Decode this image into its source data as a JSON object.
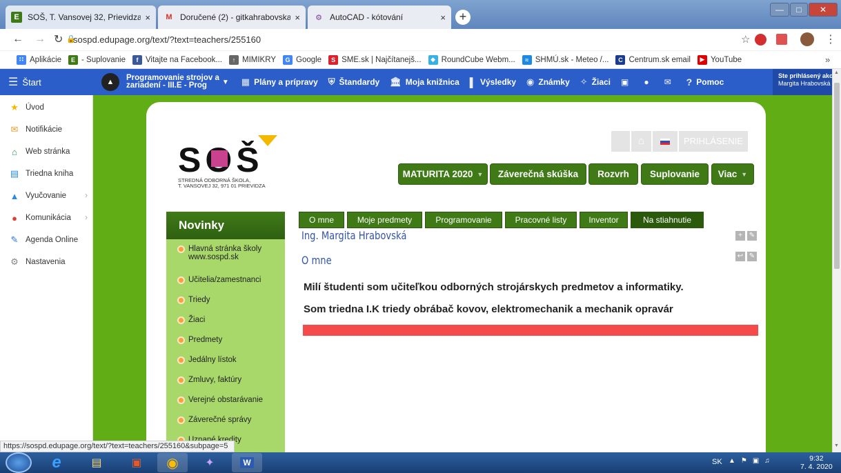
{
  "browser": {
    "tabs": [
      {
        "title": "SOŠ, T. Vansovej 32, Prievidza",
        "icon": "edupage-icon",
        "close": "×"
      },
      {
        "title": "Doručené (2) - gitkahrabovska@",
        "icon": "gmail-icon",
        "close": "×"
      },
      {
        "title": "AutoCAD - kótování",
        "icon": "autocad-icon",
        "close": "×"
      }
    ],
    "new_tab": "+",
    "url": "sospd.edupage.org/text/?text=teachers/255160",
    "bookmarks": [
      {
        "label": "Aplikácie",
        "color": "#4285f4"
      },
      {
        "label": "- Suplovanie",
        "color": "#3f7a16"
      },
      {
        "label": "Vitajte na Facebook...",
        "color": "#3b5998"
      },
      {
        "label": "MIMIKRY",
        "color": "#666666"
      },
      {
        "label": "Google",
        "color": "#4285f4"
      },
      {
        "label": "SME.sk | Najčítanejš...",
        "color": "#d9232e"
      },
      {
        "label": "RoundCube Webm...",
        "color": "#37b0e6"
      },
      {
        "label": "SHMÚ.sk - Meteo /...",
        "color": "#1e88e5"
      },
      {
        "label": "Centrum.sk email",
        "color": "#1c3d8f"
      },
      {
        "label": "YouTube",
        "color": "#e00000"
      }
    ],
    "status_url": "https://sospd.edupage.org/text/?text=teachers/255160&subpage=5"
  },
  "edupage_nav": {
    "start": "Štart",
    "course_line1": "Programovanie strojov a",
    "course_line2": "zariadení - III.E - Prog",
    "items": [
      "Plány a prípravy",
      "Štandardy",
      "Moja knižnica",
      "Výsledky",
      "Známky",
      "Žiaci"
    ],
    "help": "Pomoc",
    "logged_line1": "Ste prihlásený ako",
    "logged_line2": "Margita Hrabovská"
  },
  "sidebar": {
    "items": [
      "Úvod",
      "Notifikácie",
      "Web stránka",
      "Triedna kniha",
      "Vyučovanie",
      "Komunikácia",
      "Agenda Online",
      "Nastavenia"
    ]
  },
  "school": {
    "logo_letters": "SOŠ",
    "logo_line1": "STREDNÁ    ODBORNÁ    ŠKOLA,",
    "logo_line2": "T. VANSOVEJ  32, 971 01 PRIEVIDZA",
    "login": "PRIHLÁSENIE",
    "main_buttons": [
      "MATURITA 2020",
      "Záverečná skúška",
      "Rozvrh",
      "Suplovanie",
      "Viac"
    ],
    "sub_tabs": [
      "O mne",
      "Moje predmety",
      "Programovanie",
      "Pracovné listy",
      "Inventor",
      "Na stiahnutie"
    ],
    "news_title": "Novinky",
    "news": [
      {
        "line1": "Hlavná stránka školy",
        "line2": "www.sospd.sk"
      },
      {
        "line1": "Učitelia/zamestnanci"
      },
      {
        "line1": "Triedy"
      },
      {
        "line1": "Žiaci"
      },
      {
        "line1": "Predmety"
      },
      {
        "line1": "Jedálny lístok"
      },
      {
        "line1": "Zmluvy, faktúry"
      },
      {
        "line1": "Verejné obstarávanie"
      },
      {
        "line1": "Záverečné správy"
      },
      {
        "line1": "Uznané kredity"
      }
    ],
    "teacher_name": "Ing. Margita Hrabovská",
    "section_title": "O mne",
    "paragraph1": "Milí študenti som učiteľkou odborných strojárskych predmetov a informatiky.",
    "paragraph2": "Som triedna I.K triedy obrábač kovov, elektromechanik a mechanik opravár"
  },
  "taskbar": {
    "lang": "SK",
    "time": "9:32",
    "date": "7. 4. 2020"
  },
  "colors": {
    "nav_blue": "#2c5ec9",
    "page_green": "#60ad16",
    "button_green": "#3f7a16",
    "news_green": "#a8d86a",
    "red_bar": "#f44a4a",
    "name_blue": "#3355a8"
  }
}
